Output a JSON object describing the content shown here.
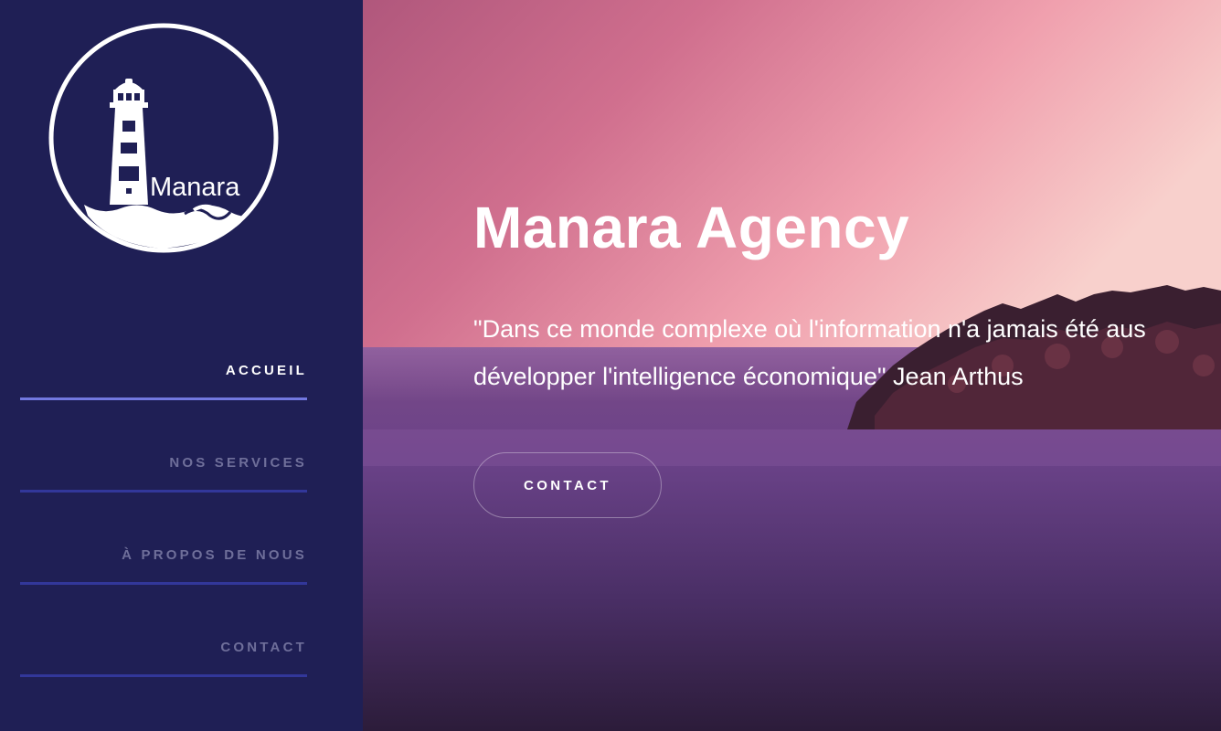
{
  "brand": {
    "logo_text": "Manara"
  },
  "sidebar": {
    "items": [
      {
        "label": "ACCUEIL",
        "active": true
      },
      {
        "label": "NOS SERVICES",
        "active": false
      },
      {
        "label": "À PROPOS DE NOUS",
        "active": false
      },
      {
        "label": "CONTACT",
        "active": false
      }
    ]
  },
  "hero": {
    "title": "Manara Agency",
    "quote_line1": "\"Dans ce monde complexe où l'information n'a jamais été aus",
    "quote_line2": "développer l'intelligence économique\" Jean Arthus",
    "cta_label": "CONTACT"
  },
  "colors": {
    "sidebar_bg": "#1f1f55",
    "nav_active": "#ffffff",
    "nav_inactive": "#6f6f9a",
    "underline_active": "#7278e0",
    "underline_inactive": "#32379a"
  }
}
